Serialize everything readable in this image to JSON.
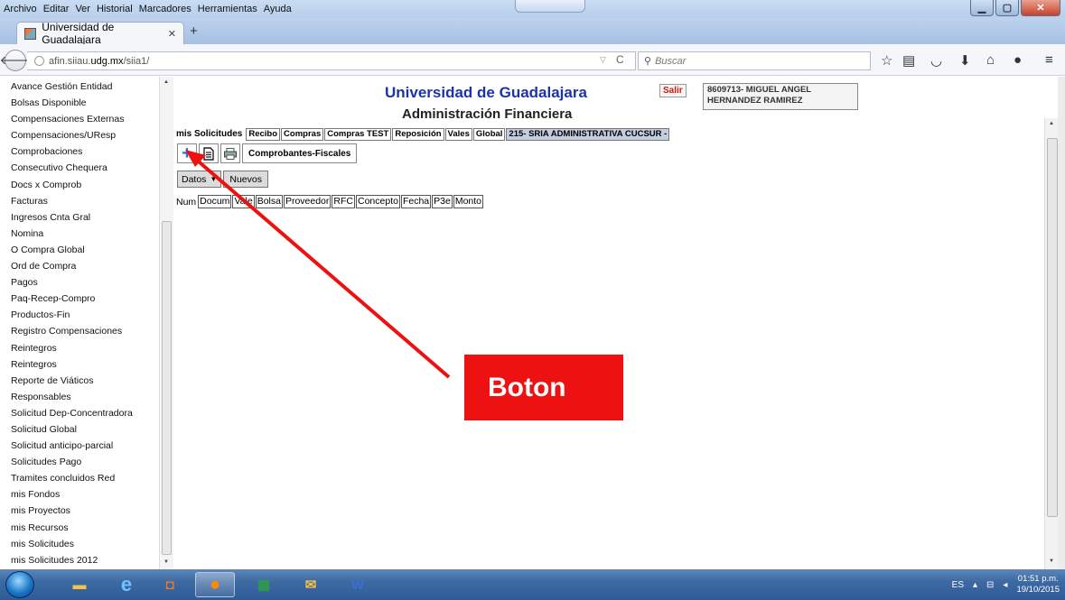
{
  "menubar": {
    "items": [
      "Archivo",
      "Editar",
      "Ver",
      "Historial",
      "Marcadores",
      "Herramientas",
      "Ayuda"
    ]
  },
  "browser": {
    "tab_title": "Universidad de Guadalajara",
    "url_prefix": "afin.siiau.",
    "url_domain": "udg.mx",
    "url_path": "/siia1/",
    "search_placeholder": "Buscar",
    "icons": [
      "star-icon",
      "reading-list-icon",
      "pocket-icon",
      "download-icon",
      "home-icon",
      "chat-icon",
      "menu-icon"
    ]
  },
  "sidebar": {
    "items": [
      "Avance Gestión Entidad",
      "Bolsas Disponible",
      "Compensaciones Externas",
      "Compensaciones/UResp",
      "Comprobaciones",
      "Consecutivo Chequera",
      "Docs x Comprob",
      "Facturas",
      "Ingresos Cnta Gral",
      "Nomina",
      "O Compra Global",
      "Ord de Compra",
      "Pagos",
      "Paq-Recep-Compro",
      "Productos-Fin",
      "Registro Compensaciones",
      "Reintegros",
      "Reintegros",
      "Reporte de Viáticos",
      "Responsables",
      "Solicitud Dep-Concentradora",
      "Solicitud Global",
      "Solicitud anticipo-parcial",
      "Solicitudes Pago",
      "Tramites concluidos Red",
      "mis Fondos",
      "mis Proyectos",
      "mis Recursos",
      "mis Solicitudes",
      "mis Solicitudes 2012"
    ]
  },
  "page": {
    "university": "Universidad de Guadalajara",
    "subtitle": "Administración Financiera",
    "salir": "Salir",
    "user_line1": "8609713- MIGUEL ANGEL",
    "user_line2": "HERNANDEZ RAMIREZ",
    "tabs_lead": "mis Solicitudes",
    "tabs": [
      "Recibo",
      "Compras",
      "Compras TEST",
      "Reposición",
      "Vales",
      "Global",
      "215- SRIA ADMINISTRATIVA CUCSUR -"
    ],
    "comprobantes_btn": "Comprobantes-Fiscales",
    "datos_label": "Datos",
    "nuevos_label": "Nuevos",
    "columns_lead": "Num",
    "columns": [
      "Docum",
      "Vale",
      "Bolsa",
      "Proveedor",
      "RFC",
      "Concepto",
      "Fecha",
      "P3e",
      "Monto"
    ]
  },
  "annotation": {
    "label": "Boton",
    "color": "#ee1111"
  },
  "taskbar": {
    "lang": "ES",
    "time": "01:51 p.m.",
    "date": "19/10/2015"
  }
}
